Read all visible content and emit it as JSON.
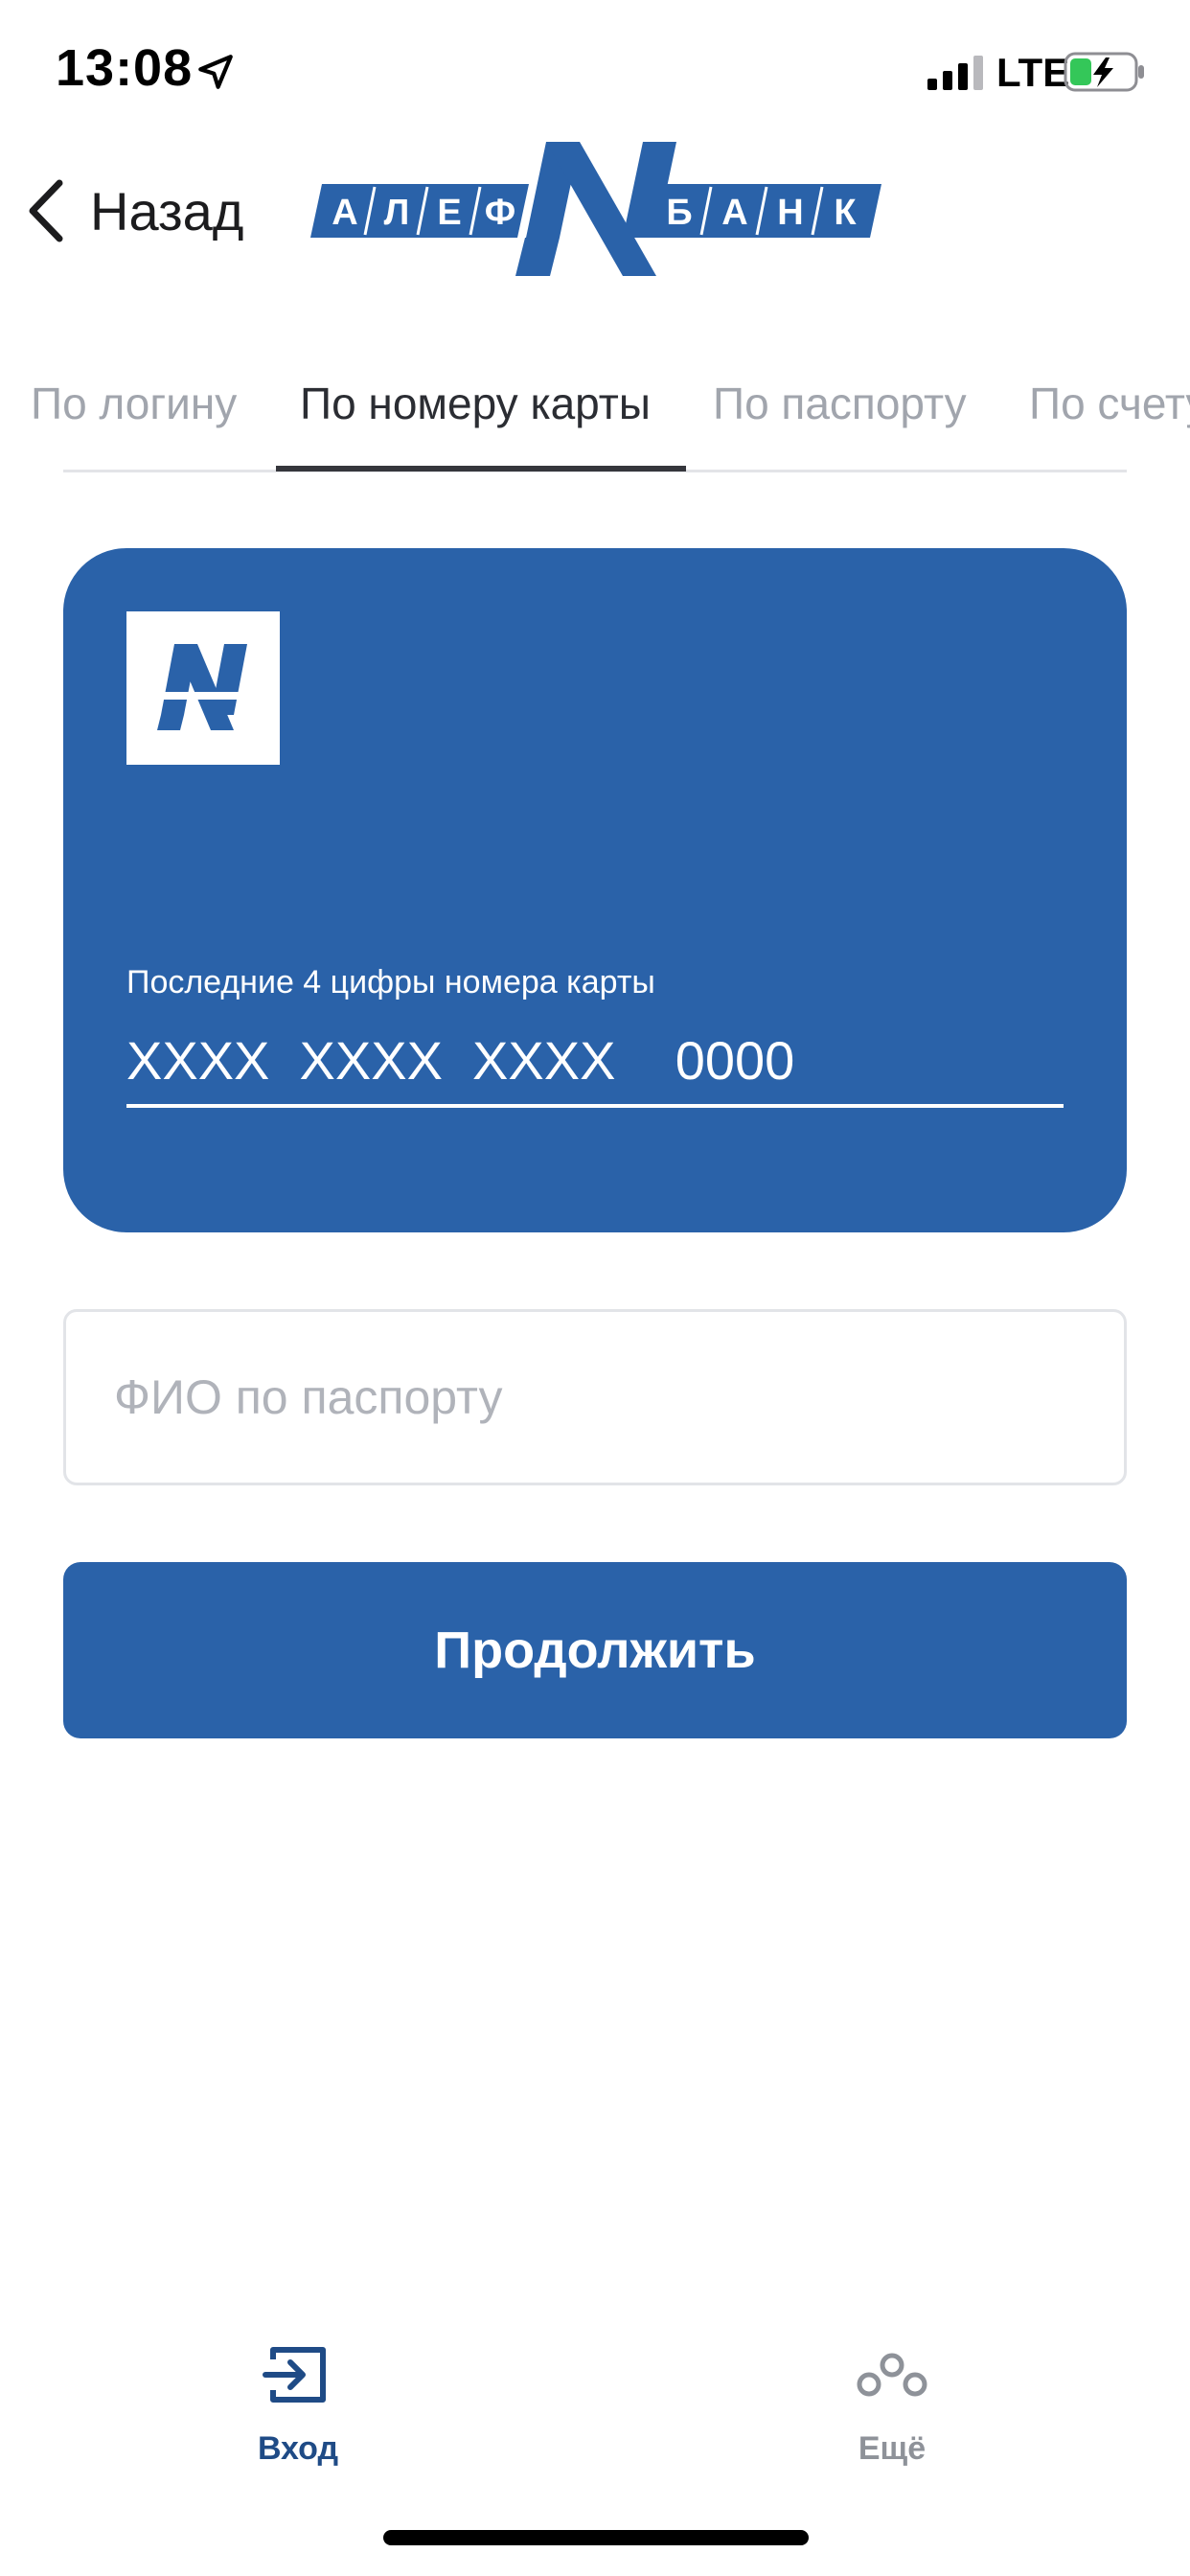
{
  "status_bar": {
    "time": "13:08",
    "network": "LTE"
  },
  "header": {
    "back_label": "Назад",
    "logo_left_letters": [
      "А",
      "Л",
      "Е",
      "Ф"
    ],
    "logo_right_letters": [
      "Б",
      "А",
      "Н",
      "К"
    ]
  },
  "tabs": [
    {
      "label": "По логину",
      "active": false
    },
    {
      "label": "По номеру карты",
      "active": true
    },
    {
      "label": "По паспорту",
      "active": false
    },
    {
      "label": "По счету",
      "active": false
    }
  ],
  "card": {
    "last_digits_label": "Последние 4 цифры номера карты",
    "number_placeholder": "XXXX  XXXX  XXXX    0000"
  },
  "name_field": {
    "placeholder": "ФИО по паспорту",
    "value": ""
  },
  "continue_label": "Продолжить",
  "bottom_nav": {
    "login_label": "Вход",
    "more_label": "Ещё"
  },
  "colors": {
    "brand_blue": "#2a62a9",
    "active_nav": "#1f4b86",
    "inactive_nav": "#8e9299",
    "battery_charge": "#34c759"
  },
  "icons": {
    "back": "chevron-left-icon",
    "location": "location-arrow-icon",
    "signal": "cellular-signal-icon",
    "battery": "battery-charging-icon",
    "login": "login-icon",
    "more": "more-dots-icon"
  }
}
